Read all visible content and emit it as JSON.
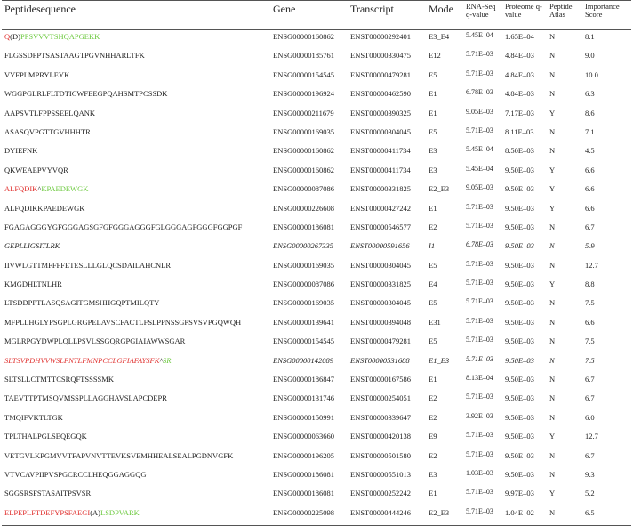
{
  "headers": {
    "peptide": "Peptidesequence",
    "gene": "Gene",
    "transcript": "Transcript",
    "mode": "Mode",
    "rnaseq": "RNA-Seq q-value",
    "proteome": "Proteome q-value",
    "atlas": "Peptide Atlas",
    "importance": "Importance Score"
  },
  "rows": [
    {
      "peptide": [
        {
          "t": "Q",
          "c": "red"
        },
        {
          "t": "(D)",
          "c": "blk"
        },
        {
          "t": "PPSVVVTSHQAPGEKK",
          "c": "green"
        }
      ],
      "gene": "ENSG00000160862",
      "transcript": "ENST00000292401",
      "mode": "E3_E4",
      "rnaseq": "5.45E–04",
      "proteome": "1.65E–04",
      "atlas": "N",
      "importance": "8.1",
      "italic": false
    },
    {
      "peptide": [
        {
          "t": "FLGSSDPPTSASTAAGTPGVNHHARLTFK",
          "c": "blk"
        }
      ],
      "gene": "ENSG00000185761",
      "transcript": "ENST00000330475",
      "mode": "E12",
      "rnaseq": "5.71E–03",
      "proteome": "4.84E–03",
      "atlas": "N",
      "importance": "9.0",
      "italic": false
    },
    {
      "peptide": [
        {
          "t": "VYFPLMPRYLEYK",
          "c": "blk"
        }
      ],
      "gene": "ENSG00000154545",
      "transcript": "ENST00000479281",
      "mode": "E5",
      "rnaseq": "5.71E–03",
      "proteome": "4.84E–03",
      "atlas": "N",
      "importance": "10.0",
      "italic": false
    },
    {
      "peptide": [
        {
          "t": "WGGPGLRLFLTDTICWFEEGPQAHSMTPCSSDK",
          "c": "blk"
        }
      ],
      "gene": "ENSG00000196924",
      "transcript": "ENST00000462590",
      "mode": "E1",
      "rnaseq": "6.78E–03",
      "proteome": "4.84E–03",
      "atlas": "N",
      "importance": "6.3",
      "italic": false
    },
    {
      "peptide": [
        {
          "t": "AAPSVTLFPPSSEELQANK",
          "c": "blk"
        }
      ],
      "gene": "ENSG00000211679",
      "transcript": "ENST00000390325",
      "mode": "E1",
      "rnaseq": "9.05E–03",
      "proteome": "7.17E–03",
      "atlas": "Y",
      "importance": "8.6",
      "italic": false
    },
    {
      "peptide": [
        {
          "t": "ASASQVPGTTGVHHHTR",
          "c": "blk"
        }
      ],
      "gene": "ENSG00000169035",
      "transcript": "ENST00000304045",
      "mode": "E5",
      "rnaseq": "5.71E–03",
      "proteome": "8.11E–03",
      "atlas": "N",
      "importance": "7.1",
      "italic": false
    },
    {
      "peptide": [
        {
          "t": "DYIEFNK",
          "c": "blk"
        }
      ],
      "gene": "ENSG00000160862",
      "transcript": "ENST00000411734",
      "mode": "E3",
      "rnaseq": "5.45E–04",
      "proteome": "8.50E–03",
      "atlas": "N",
      "importance": "4.5",
      "italic": false
    },
    {
      "peptide": [
        {
          "t": "QKWEAEPVYVQR",
          "c": "blk"
        }
      ],
      "gene": "ENSG00000160862",
      "transcript": "ENST00000411734",
      "mode": "E3",
      "rnaseq": "5.45E–04",
      "proteome": "9.50E–03",
      "atlas": "Y",
      "importance": "6.6",
      "italic": false
    },
    {
      "peptide": [
        {
          "t": "ALFQDIK",
          "c": "red"
        },
        {
          "t": "^",
          "c": "blk"
        },
        {
          "t": "KPAEDEWGK",
          "c": "green"
        }
      ],
      "gene": "ENSG00000087086",
      "transcript": "ENST00000331825",
      "mode": "E2_E3",
      "rnaseq": "9.05E–03",
      "proteome": "9.50E–03",
      "atlas": "Y",
      "importance": "6.6",
      "italic": false
    },
    {
      "peptide": [
        {
          "t": "ALFQDIKKPAEDEWGK",
          "c": "blk"
        }
      ],
      "gene": "ENSG00000226608",
      "transcript": "ENST00000427242",
      "mode": "E1",
      "rnaseq": "5.71E–03",
      "proteome": "9.50E–03",
      "atlas": "Y",
      "importance": "6.6",
      "italic": false
    },
    {
      "peptide": [
        {
          "t": "FGAGAGGGYGFGGGAGSGFGFGGGAGGGFGLGGGAGFGGGFGGPGF",
          "c": "blk"
        }
      ],
      "gene": "ENSG00000186081",
      "transcript": "ENST00000546577",
      "mode": "E2",
      "rnaseq": "5.71E–03",
      "proteome": "9.50E–03",
      "atlas": "N",
      "importance": "6.7",
      "italic": false
    },
    {
      "peptide": [
        {
          "t": "GEPLLIGSITLRK",
          "c": "blk"
        }
      ],
      "gene": "ENSG00000267335",
      "transcript": "ENST00000591656",
      "mode": "I1",
      "rnaseq": "6.78E–03",
      "proteome": "9.50E–03",
      "atlas": "N",
      "importance": "5.9",
      "italic": true
    },
    {
      "peptide": [
        {
          "t": "IIVWLGTTMFFFFETESLLLGLQCSDAILAHCNLR",
          "c": "blk"
        }
      ],
      "gene": "ENSG00000169035",
      "transcript": "ENST00000304045",
      "mode": "E5",
      "rnaseq": "5.71E–03",
      "proteome": "9.50E–03",
      "atlas": "N",
      "importance": "12.7",
      "italic": false
    },
    {
      "peptide": [
        {
          "t": "KMGDHLTNLHR",
          "c": "blk"
        }
      ],
      "gene": "ENSG00000087086",
      "transcript": "ENST00000331825",
      "mode": "E4",
      "rnaseq": "5.71E–03",
      "proteome": "9.50E–03",
      "atlas": "Y",
      "importance": "8.8",
      "italic": false
    },
    {
      "peptide": [
        {
          "t": "LTSDDPPTLASQSAGITGMSHHGQPTMILQTY",
          "c": "blk"
        }
      ],
      "gene": "ENSG00000169035",
      "transcript": "ENST00000304045",
      "mode": "E5",
      "rnaseq": "5.71E–03",
      "proteome": "9.50E–03",
      "atlas": "N",
      "importance": "7.5",
      "italic": false
    },
    {
      "peptide": [
        {
          "t": "MFPLLHGLYPSGPLGRGPELAVSCFACTLFSLPPNSSGPSVSVPGQWQH",
          "c": "blk"
        }
      ],
      "gene": "ENSG00000139641",
      "transcript": "ENST00000394048",
      "mode": "E31",
      "rnaseq": "5.71E–03",
      "proteome": "9.50E–03",
      "atlas": "N",
      "importance": "6.6",
      "italic": false
    },
    {
      "peptide": [
        {
          "t": "MGLRPGYDWPLQLLPSVLSSGQRGPGIAIAWWSGAR",
          "c": "blk"
        }
      ],
      "gene": "ENSG00000154545",
      "transcript": "ENST00000479281",
      "mode": "E5",
      "rnaseq": "5.71E–03",
      "proteome": "9.50E–03",
      "atlas": "N",
      "importance": "7.5",
      "italic": false
    },
    {
      "peptide": [
        {
          "t": "SLTSVPDHVVWSLFNTLFMNPCCLGFIAFAYSFK",
          "c": "red"
        },
        {
          "t": "^",
          "c": "blk"
        },
        {
          "t": "SR",
          "c": "green"
        }
      ],
      "gene": "ENSG00000142089",
      "transcript": "ENST00000531688",
      "mode": "E1_E3",
      "rnaseq": "5.71E–03",
      "proteome": "9.50E–03",
      "atlas": "N",
      "importance": "7.5",
      "italic": true
    },
    {
      "peptide": [
        {
          "t": "SLTSLLCTMTTCSRQFTSSSSMK",
          "c": "blk"
        }
      ],
      "gene": "ENSG00000186847",
      "transcript": "ENST00000167586",
      "mode": "E1",
      "rnaseq": "8.13E–04",
      "proteome": "9.50E–03",
      "atlas": "N",
      "importance": "6.7",
      "italic": false
    },
    {
      "peptide": [
        {
          "t": "TAEVTTPTMSQVMSSPLLAGGHAVSLAPCDEPR",
          "c": "blk"
        }
      ],
      "gene": "ENSG00000131746",
      "transcript": "ENST00000254051",
      "mode": "E2",
      "rnaseq": "5.71E–03",
      "proteome": "9.50E–03",
      "atlas": "N",
      "importance": "6.7",
      "italic": false
    },
    {
      "peptide": [
        {
          "t": "TMQIFVKTLTGK",
          "c": "blk"
        }
      ],
      "gene": "ENSG00000150991",
      "transcript": "ENST00000339647",
      "mode": "E2",
      "rnaseq": "3.92E–03",
      "proteome": "9.50E–03",
      "atlas": "N",
      "importance": "6.0",
      "italic": false
    },
    {
      "peptide": [
        {
          "t": "TPLTHALPGLSEQEGQK",
          "c": "blk"
        }
      ],
      "gene": "ENSG00000063660",
      "transcript": "ENST00000420138",
      "mode": "E9",
      "rnaseq": "5.71E–03",
      "proteome": "9.50E–03",
      "atlas": "Y",
      "importance": "12.7",
      "italic": false
    },
    {
      "peptide": [
        {
          "t": "VETGVLKPGMVVTFAPVNVTTEVKSVEMHHEALSEALPGDNVGFK",
          "c": "blk"
        }
      ],
      "gene": "ENSG00000196205",
      "transcript": "ENST00000501580",
      "mode": "E2",
      "rnaseq": "5.71E–03",
      "proteome": "9.50E–03",
      "atlas": "N",
      "importance": "6.7",
      "italic": false
    },
    {
      "peptide": [
        {
          "t": "VTVCAVPIIPVSPGCRCCLHEQGGAGGQG",
          "c": "blk"
        }
      ],
      "gene": "ENSG00000186081",
      "transcript": "ENST00000551013",
      "mode": "E3",
      "rnaseq": "1.03E–03",
      "proteome": "9.50E–03",
      "atlas": "N",
      "importance": "9.3",
      "italic": false
    },
    {
      "peptide": [
        {
          "t": "SGGSRSFSTASAITPSVSR",
          "c": "blk"
        }
      ],
      "gene": "ENSG00000186081",
      "transcript": "ENST00000252242",
      "mode": "E1",
      "rnaseq": "5.71E–03",
      "proteome": "9.97E–03",
      "atlas": "Y",
      "importance": "5.2",
      "italic": false
    },
    {
      "peptide": [
        {
          "t": "ELPEPLFTDEFYPSFAEGI",
          "c": "red"
        },
        {
          "t": "(A)",
          "c": "blk"
        },
        {
          "t": "LSDPVARK",
          "c": "green"
        }
      ],
      "gene": "ENSG00000225098",
      "transcript": "ENST00000444246",
      "mode": "E2_E3",
      "rnaseq": "5.71E–03",
      "proteome": "1.04E–02",
      "atlas": "N",
      "importance": "6.5",
      "italic": false
    }
  ]
}
